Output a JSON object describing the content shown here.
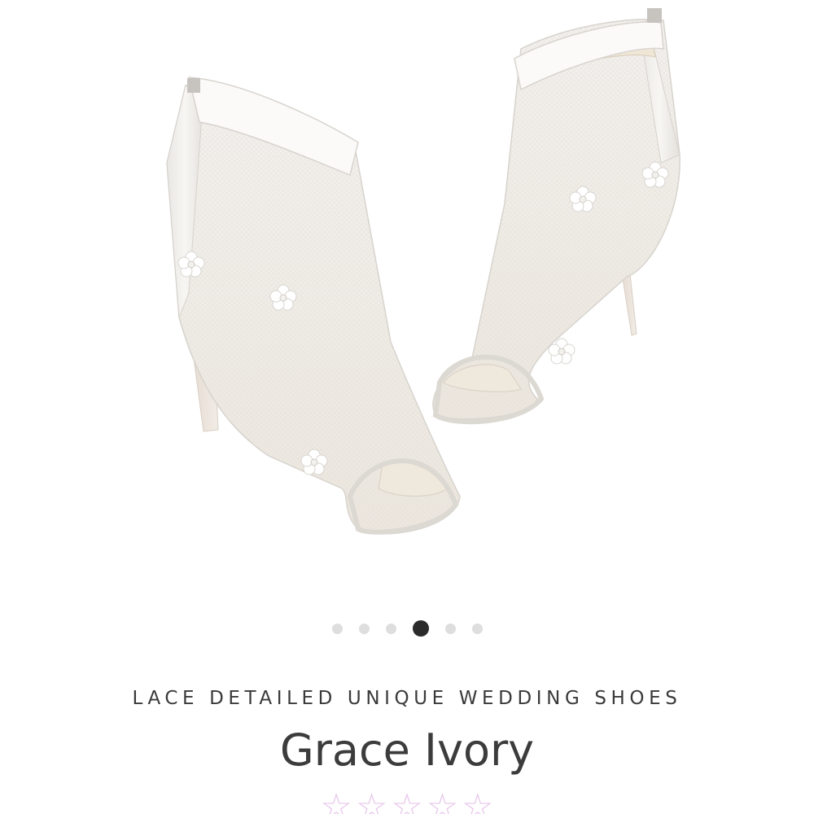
{
  "product": {
    "image_icon": "wedding-shoe-photo",
    "subtitle": "LACE DETAILED UNIQUE WEDDING SHOES",
    "title": "Grace Ivory"
  },
  "carousel": {
    "count": 6,
    "active_index": 3,
    "dot_color": "#dedede",
    "active_color": "#2b2b2b"
  },
  "rating": {
    "stars": [
      "☆",
      "☆",
      "☆",
      "☆",
      "☆"
    ],
    "filled": 0,
    "star_color": "#e7c6ea"
  }
}
